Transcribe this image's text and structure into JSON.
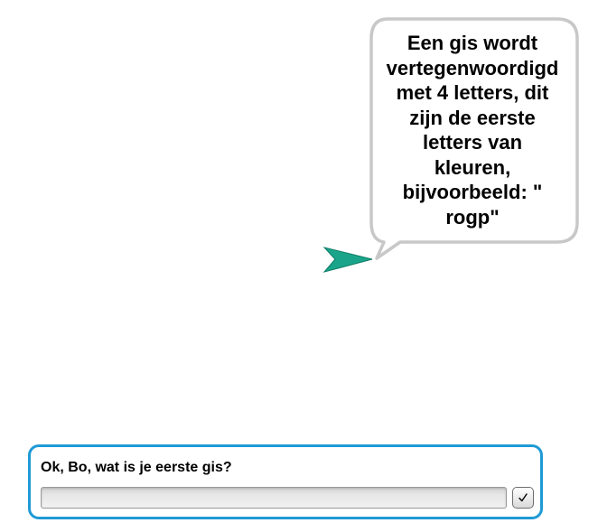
{
  "stage": {
    "sprite_icon": "green-arrow-sprite-icon",
    "sprite_color": "#1aa58a",
    "speech_bubble": {
      "text": "Een gis wordt\nvertegenwoordigd\nmet  4 letters, dit\nzijn de eerste\nletters van\nkleuren,\nbijvoorbeeld: \"\nrogp\"",
      "border_color": "#c8c8c8"
    }
  },
  "ask_prompt": {
    "question": "Ok, Bo, wat is je eerste gis?",
    "input_value": "",
    "submit_icon": "checkmark-icon",
    "border_color": "#1f9ad6"
  }
}
